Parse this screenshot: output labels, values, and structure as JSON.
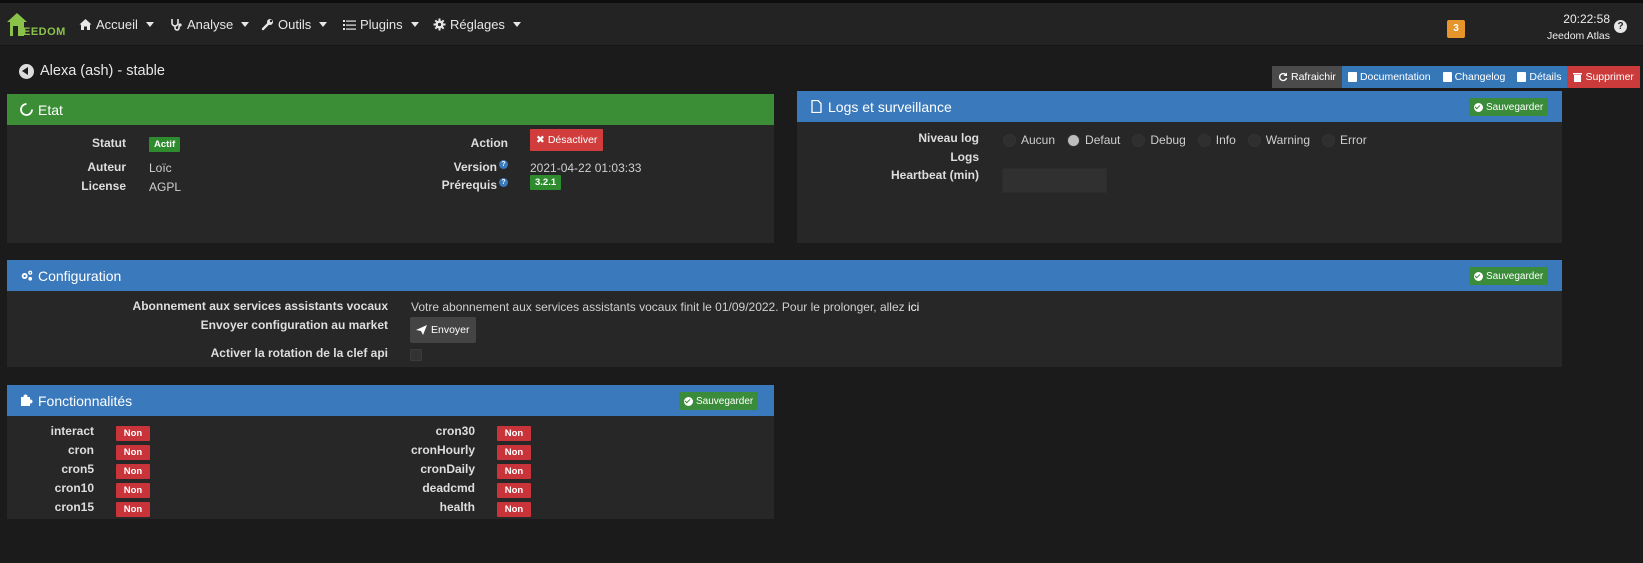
{
  "nav": {
    "logo_text": "EEDOM",
    "items": [
      {
        "label": "Accueil",
        "icon": "home-icon"
      },
      {
        "label": "Analyse",
        "icon": "stethoscope-icon"
      },
      {
        "label": "Outils",
        "icon": "wrench-icon"
      },
      {
        "label": "Plugins",
        "icon": "list-icon"
      },
      {
        "label": "Réglages",
        "icon": "cog-icon"
      }
    ],
    "notification_count": "3",
    "time": "20:22:58",
    "user": "Jeedom Atlas"
  },
  "page": {
    "title": "Alexa (ash) - stable"
  },
  "toolbar": {
    "refresh": "Rafraichir",
    "documentation": "Documentation",
    "changelog": "Changelog",
    "details": "Détails",
    "delete": "Supprimer"
  },
  "etat": {
    "title": "Etat",
    "statut_label": "Statut",
    "statut_value": "Actif",
    "auteur_label": "Auteur",
    "auteur_value": "Loïc",
    "license_label": "License",
    "license_value": "AGPL",
    "action_label": "Action",
    "action_button": "Désactiver",
    "version_label": "Version",
    "version_value": "2021-04-22 01:03:33",
    "prerequis_label": "Prérequis",
    "prerequis_value": "3.2.1"
  },
  "logs": {
    "title": "Logs et surveillance",
    "save": "Sauvegarder",
    "niveau_label": "Niveau log",
    "levels": [
      "Aucun",
      "Defaut",
      "Debug",
      "Info",
      "Warning",
      "Error"
    ],
    "selected_level": "Defaut",
    "logs_label": "Logs",
    "heartbeat_label": "Heartbeat (min)",
    "heartbeat_value": ""
  },
  "config": {
    "title": "Configuration",
    "save": "Sauvegarder",
    "abonnement_label": "Abonnement aux services assistants vocaux",
    "abonnement_text": "Votre abonnement aux services assistants vocaux finit le 01/09/2022. Pour le prolonger, allez",
    "abonnement_link": "ici",
    "envoyer_label": "Envoyer configuration au market",
    "envoyer_button": "Envoyer",
    "rotation_label": "Activer la rotation de la clef api"
  },
  "fonctionnalites": {
    "title": "Fonctionnalités",
    "save": "Sauvegarder",
    "left": [
      {
        "name": "interact",
        "value": "Non"
      },
      {
        "name": "cron",
        "value": "Non"
      },
      {
        "name": "cron5",
        "value": "Non"
      },
      {
        "name": "cron10",
        "value": "Non"
      },
      {
        "name": "cron15",
        "value": "Non"
      }
    ],
    "right": [
      {
        "name": "cron30",
        "value": "Non"
      },
      {
        "name": "cronHourly",
        "value": "Non"
      },
      {
        "name": "cronDaily",
        "value": "Non"
      },
      {
        "name": "deadcmd",
        "value": "Non"
      },
      {
        "name": "health",
        "value": "Non"
      }
    ]
  },
  "colors": {
    "green": "#3b8e35",
    "blue": "#3a79bb",
    "red": "#c8343a",
    "orange": "#e6952b"
  }
}
